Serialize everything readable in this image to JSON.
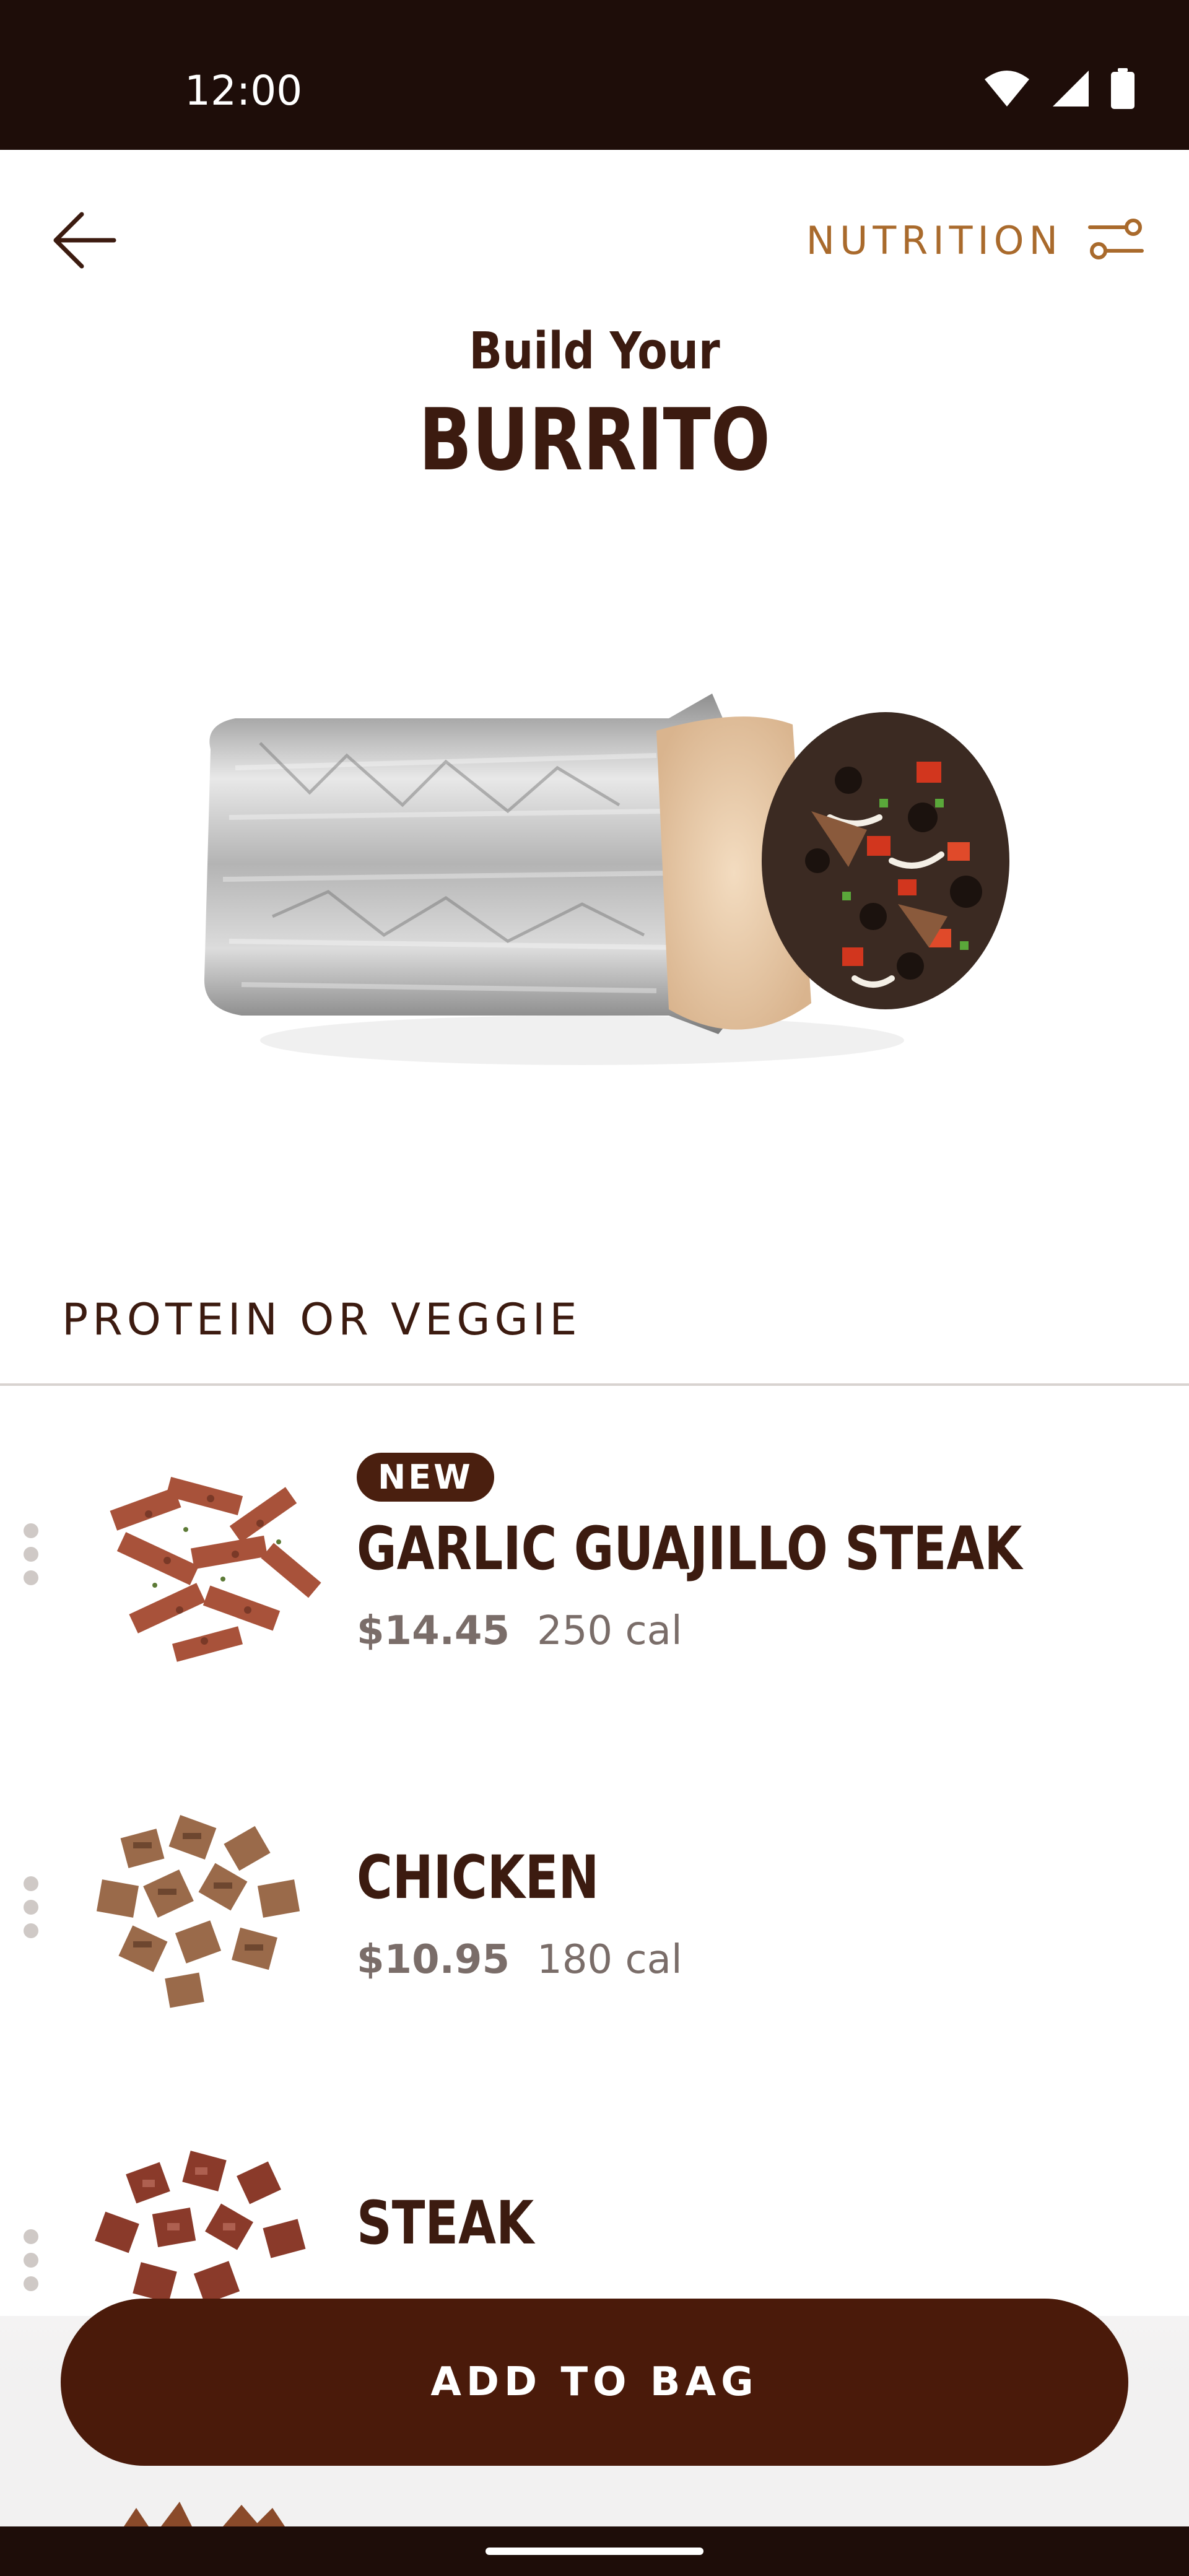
{
  "status_bar": {
    "time": "12:00",
    "icons": [
      "wifi-icon",
      "signal-icon",
      "battery-icon"
    ]
  },
  "top_bar": {
    "back_icon": "arrow-left-icon",
    "nutrition_label": "NUTRITION",
    "nutrition_icon": "sliders-icon"
  },
  "header": {
    "subtitle": "Build Your",
    "title": "BURRITO"
  },
  "section": {
    "heading": "PROTEIN OR VEGGIE"
  },
  "items": [
    {
      "badge": "NEW",
      "name": "GARLIC GUAJILLO STEAK",
      "price": "$14.45",
      "calories": "250 cal"
    },
    {
      "name": "CHICKEN",
      "price": "$10.95",
      "calories": "180 cal"
    },
    {
      "name": "STEAK"
    }
  ],
  "cta": {
    "label": "ADD TO BAG"
  },
  "colors": {
    "brand_brown": "#451a03",
    "accent_gold": "#a96a2c",
    "status_bar": "#1e0d09"
  }
}
